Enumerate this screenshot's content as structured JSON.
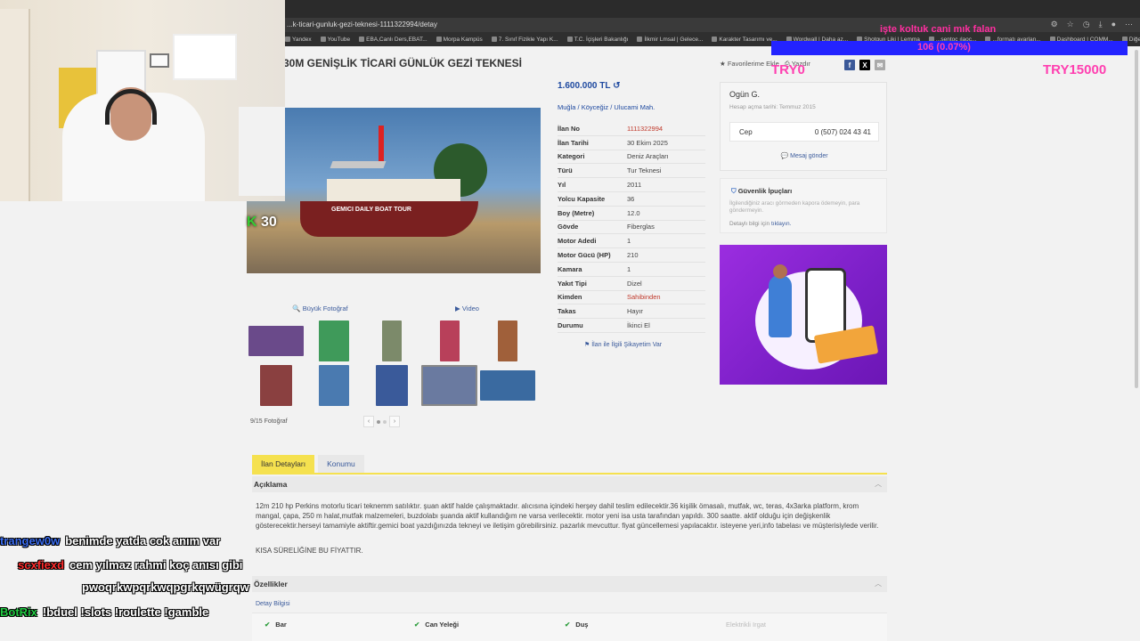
{
  "browser": {
    "url": "...k-ticari-gunluk-gezi-teknesi-1111322994/detay",
    "bookmarks": [
      "Yandex",
      "YouTube",
      "EBA,Canlı Ders,EBAT...",
      "Morpa Kampüs",
      "7. Sınıf Fizikle Yapı K...",
      "T.C. İçişleri Bakanlığı",
      "İlkmir Lmsal | Gelece...",
      "Karakter Tasarımı ve...",
      "Wordwall | Daha az...",
      "Shotgun Liki | Lemma",
      "...sentoc ılaoc...",
      "...formatı ayarlan...",
      "Dashboard | COMM...",
      "Diğer yer işaretleri"
    ]
  },
  "listing": {
    "title": "30M GENİŞLİK TİCARİ GÜNLÜK GEZİ TEKNESİ",
    "favorite_label": "Favorilerime Ekle",
    "print_label": "Yazdır",
    "price": "1.600.000 TL",
    "breadcrumb": [
      "Muğla",
      "Köyceğiz",
      "Ulucami Mah."
    ],
    "details": [
      {
        "label": "İlan No",
        "value": "1111322994",
        "highlight": true
      },
      {
        "label": "İlan Tarihi",
        "value": "30 Ekim 2025"
      },
      {
        "label": "Kategori",
        "value": "Deniz Araçları"
      },
      {
        "label": "Türü",
        "value": "Tur Teknesi"
      },
      {
        "label": "Yıl",
        "value": "2011"
      },
      {
        "label": "Yolcu Kapasite",
        "value": "36"
      },
      {
        "label": "Boy (Metre)",
        "value": "12.0"
      },
      {
        "label": "Gövde",
        "value": "Fiberglas"
      },
      {
        "label": "Motor Adedi",
        "value": "1"
      },
      {
        "label": "Motor Gücü (HP)",
        "value": "210"
      },
      {
        "label": "Kamara",
        "value": "1"
      },
      {
        "label": "Yakıt Tipi",
        "value": "Dizel"
      },
      {
        "label": "Kimden",
        "value": "Sahibinden",
        "highlight": true
      },
      {
        "label": "Takas",
        "value": "Hayır"
      },
      {
        "label": "Durumu",
        "value": "İkinci El"
      }
    ],
    "complaint_link": "İlan ile İlgili Şikayetim Var",
    "photo_links": {
      "big_photo": "Büyük Fotoğraf",
      "video": "Video"
    },
    "photo_count": "9/15 Fotoğraf",
    "boat_name": "GEMICI  DAILY BOAT TOUR"
  },
  "seller": {
    "name": "Ogün G.",
    "since": "Hesap açma tarihi: Temmuz 2015",
    "phone_label": "Cep",
    "phone": "0 (507) 024 43 41",
    "message_label": "Mesaj gönder"
  },
  "tips": {
    "title": "Güvenlik İpuçları",
    "text": "İlgilendiğiniz aracı görmeden kapora ödemeyin, para göndermeyin.",
    "link_prefix": "Detaylı bilgi için",
    "link_label": "tıklayın."
  },
  "tabs": [
    {
      "label": "İlan Detayları",
      "active": true
    },
    {
      "label": "Konumu",
      "active": false
    }
  ],
  "description": {
    "header": "Açıklama",
    "text": "12m 210 hp Perkins motorlu ticari teknemm satılıktır. şuan aktif halde çalışmaktadır. alıcısına içindeki herşey dahil teslim edilecektir.36 kişilik ömasalı, mutfak, wc, teras, 4x3arka platform, krom mangal, çapa, 250 m halat,mutfak malzemeleri, buzdolabı şuanda aktif kullandığım ne varsa verilecektir. motor yeni isa usta tarafından yapıldı. 300 saatte. aktif olduğu için değişkenlik gösterecektir.herseyi tamamiyle aktiftir.gemici boat yazdığınızda tekneyi ve iletişim görebilirsiniz. pazarlık mevcuttur. fiyat güncellemesi yapılacaktır. isteyene yeri,info tabelası ve müşterisiylede verilir.",
    "cta": "KISA SÜRELİĞİNE BU FİYATTIR."
  },
  "features": {
    "header": "Özellikler",
    "detail_info": "Detay Bilgisi",
    "items": [
      {
        "label": "Bar",
        "checked": true
      },
      {
        "label": "Can Yeleği",
        "checked": true
      },
      {
        "label": "Duş",
        "checked": true
      },
      {
        "label": "Elektrikli Irgat",
        "checked": false
      }
    ]
  },
  "stream": {
    "overlay_text": "işte koltuk cani mık falan",
    "overlay_pct": "106 (0.07%)",
    "try_left": "TRY0",
    "try_right": "TRY15000",
    "k30_prefix": "K",
    "k30_value": "30",
    "chat": [
      {
        "user": "trangew0w",
        "color": "#3a6cf0",
        "msg": "benimde yatda cok anım var"
      },
      {
        "user": "scxfiexd",
        "color": "#ff2d2d",
        "msg": "cem yılmaz rahmi koç anısı gibi"
      },
      {
        "user": "",
        "color": "#ffffff",
        "msg": "pwoqrkwpqrkwqpgrkqwügrqw"
      },
      {
        "user": "BotRix",
        "color": "#22cc44",
        "msg": "!bduel !slots !roulette !gamble"
      }
    ]
  },
  "colors": {
    "accent_yellow": "#f5e14f",
    "link_blue": "#3b5b9c",
    "price_blue": "#1f4aa0",
    "highlight_red": "#c0392b",
    "overlay_pink": "#ff3fb0"
  }
}
